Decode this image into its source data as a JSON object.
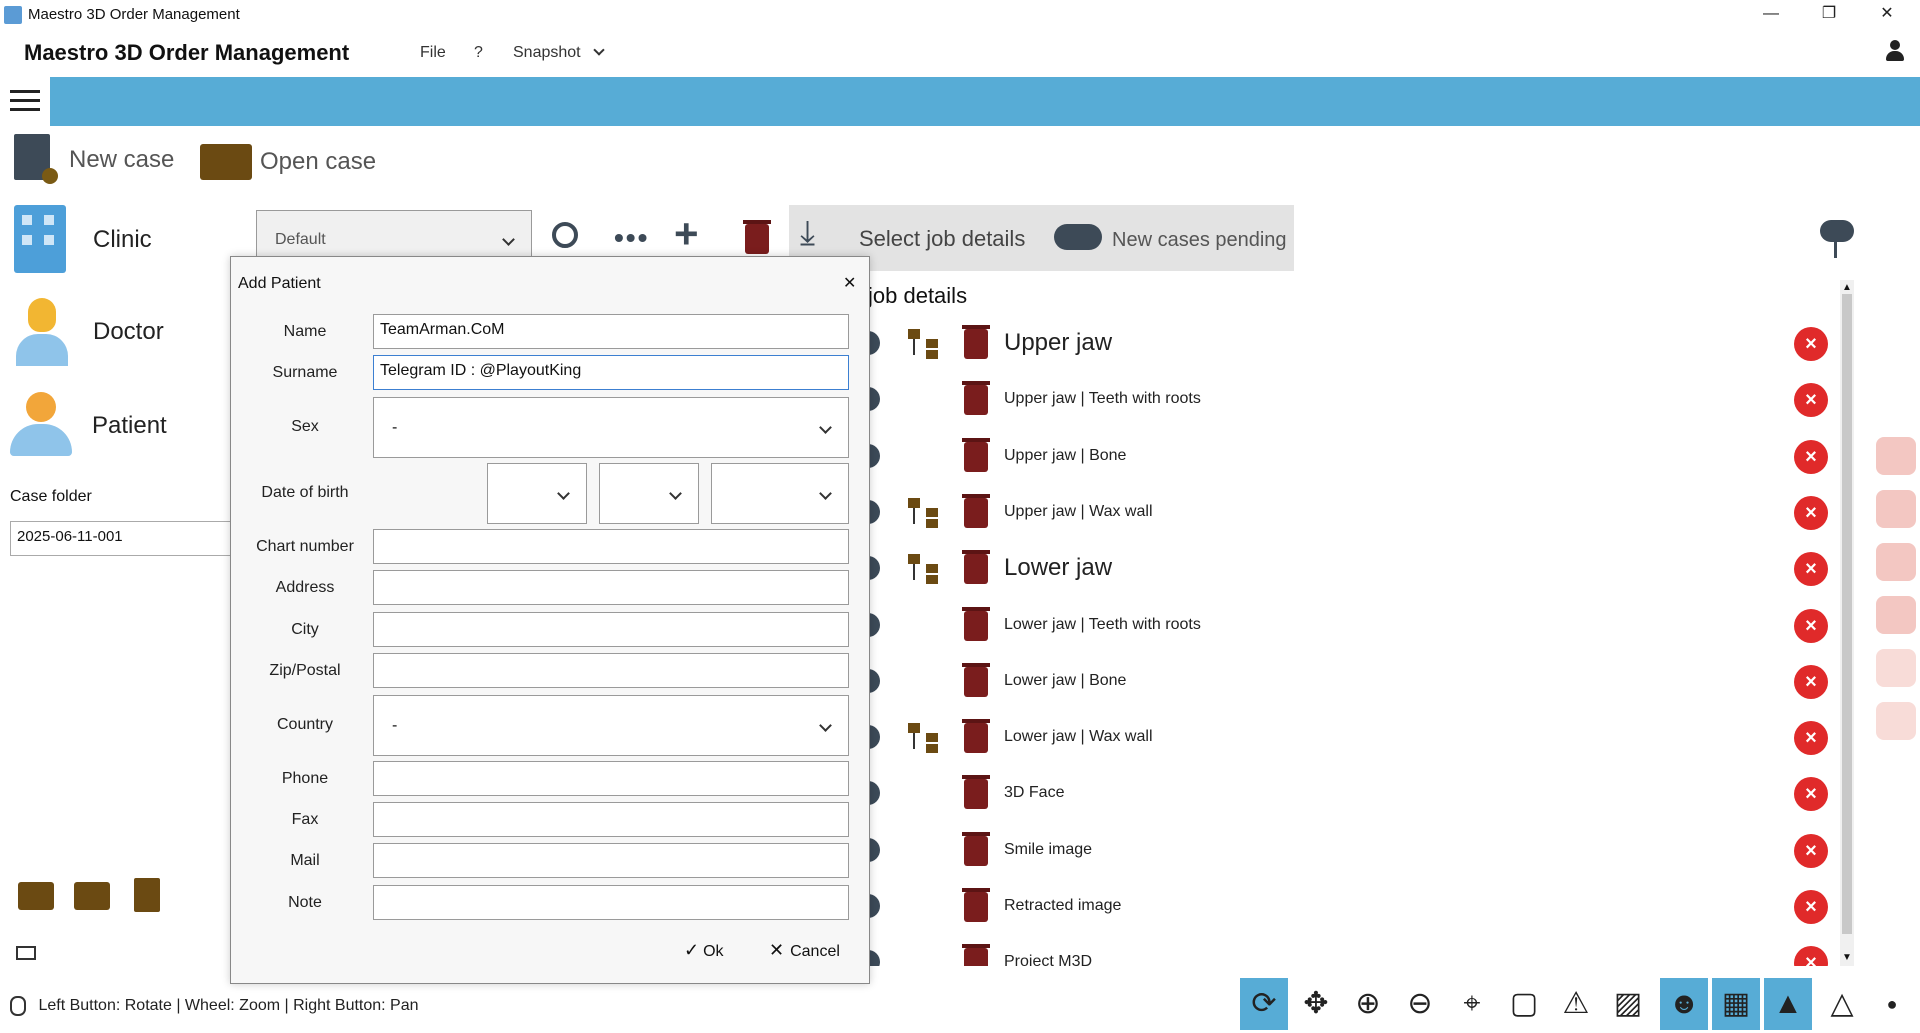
{
  "window": {
    "title": "Maestro 3D Order Management",
    "minimize": "—",
    "restore": "❐",
    "close": "✕"
  },
  "menu": {
    "app_title": "Maestro 3D Order Management",
    "file": "File",
    "help": "?",
    "snapshot": "Snapshot"
  },
  "toolbar": {
    "new_case": "New case",
    "open_case": "Open case"
  },
  "sidebar": {
    "clinic": "Clinic",
    "doctor": "Doctor",
    "patient": "Patient",
    "case_folder_label": "Case folder",
    "case_folder_value": "2025-06-11-001"
  },
  "clinic_select": {
    "value": "Default"
  },
  "actions": {
    "select_job_details": "Select job details",
    "new_cases_pending": "New cases pending"
  },
  "job_details": {
    "heading": "job details",
    "rows": [
      {
        "label": "Upper jaw",
        "big": true,
        "tree": true
      },
      {
        "label": "Upper jaw | Teeth with roots",
        "big": false,
        "tree": false
      },
      {
        "label": "Upper jaw | Bone",
        "big": false,
        "tree": false
      },
      {
        "label": "Upper jaw | Wax wall",
        "big": false,
        "tree": true
      },
      {
        "label": "Lower jaw",
        "big": true,
        "tree": true
      },
      {
        "label": "Lower jaw | Teeth with roots",
        "big": false,
        "tree": false
      },
      {
        "label": "Lower jaw | Bone",
        "big": false,
        "tree": false
      },
      {
        "label": "Lower jaw | Wax wall",
        "big": false,
        "tree": true
      },
      {
        "label": "3D Face",
        "big": false,
        "tree": false
      },
      {
        "label": "Smile image",
        "big": false,
        "tree": false
      },
      {
        "label": "Retracted image",
        "big": false,
        "tree": false
      },
      {
        "label": "Project M3D",
        "big": false,
        "tree": false
      }
    ]
  },
  "dialog": {
    "title": "Add Patient",
    "close": "✕",
    "name_label": "Name",
    "name_value": "TeamArman.CoM",
    "surname_label": "Surname",
    "surname_value": "Telegram ID  : @PlayoutKing",
    "sex_label": "Sex",
    "sex_value": "-",
    "dob_label": "Date of birth",
    "chart_label": "Chart number",
    "address_label": "Address",
    "city_label": "City",
    "zip_label": "Zip/Postal",
    "country_label": "Country",
    "country_value": "-",
    "phone_label": "Phone",
    "fax_label": "Fax",
    "mail_label": "Mail",
    "note_label": "Note",
    "ok": "Ok",
    "cancel": "Cancel"
  },
  "status": {
    "hint": "Left Button: Rotate | Wheel: Zoom | Right Button: Pan"
  },
  "colors": {
    "accent": "#57acd6",
    "delete_red": "#e02a2a",
    "trash": "#7a1d1d",
    "folder": "#6b4a12"
  }
}
